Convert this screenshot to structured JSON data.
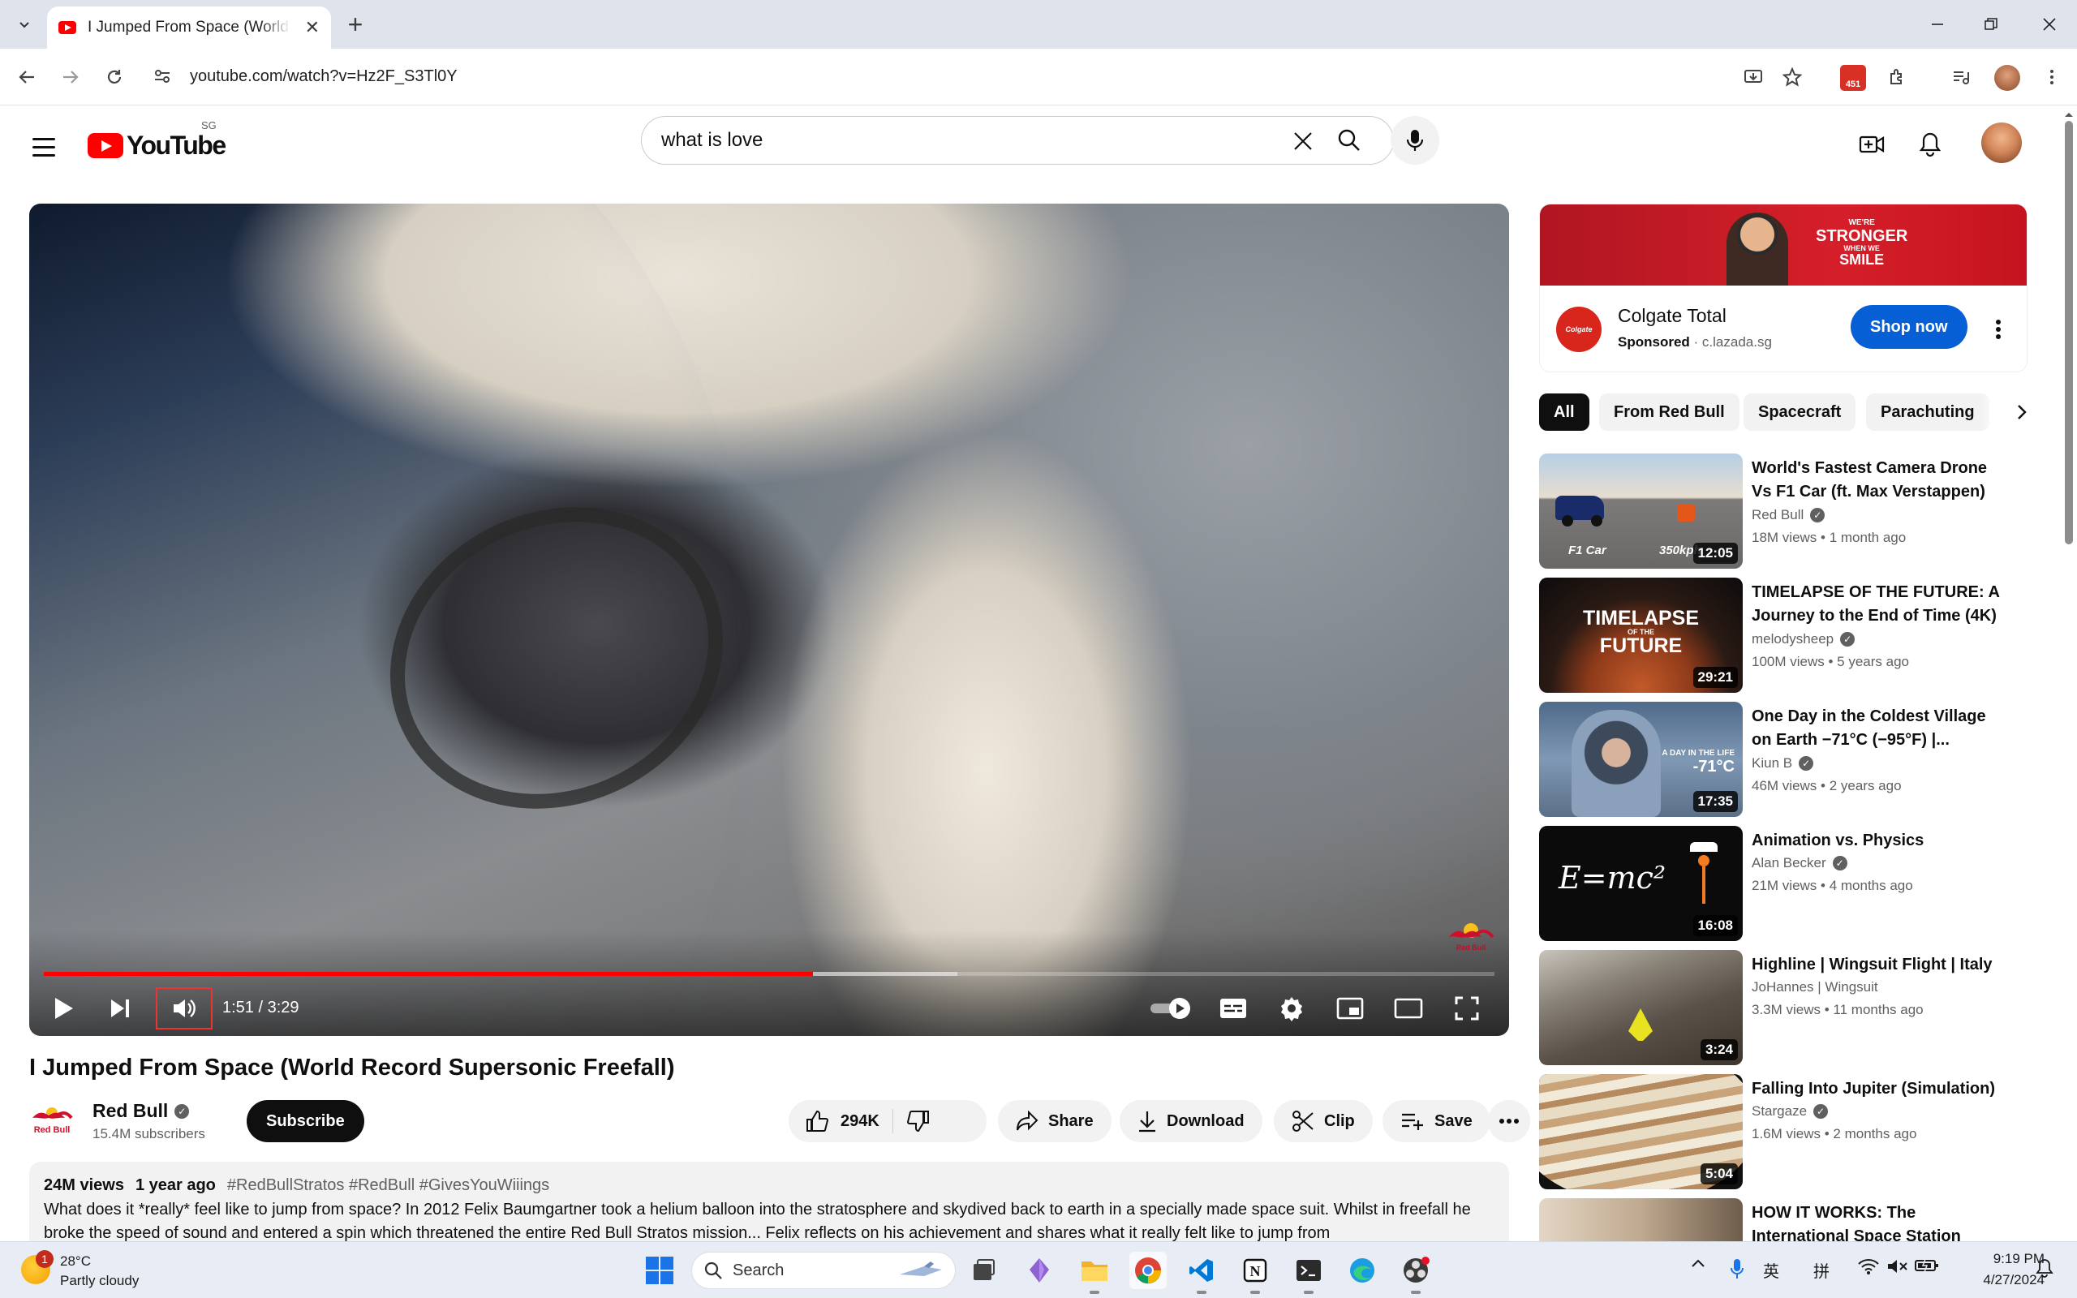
{
  "browser": {
    "tab_title": "I Jumped From Space (World Record Supersonic Freefall) - YouTube",
    "url": "youtube.com/watch?v=Hz2F_S3Tl0Y",
    "extension_badge": "451"
  },
  "youtube": {
    "logo_text": "YouTube",
    "country_code": "SG",
    "search_value": "what is love"
  },
  "player": {
    "time": "1:51 / 3:29",
    "progress_fraction": 0.53,
    "buffered_fraction": 0.63
  },
  "video": {
    "title": "I Jumped From Space (World Record Supersonic Freefall)",
    "channel": "Red Bull",
    "subscribers": "15.4M subscribers",
    "subscribe_label": "Subscribe",
    "likes": "294K",
    "share_label": "Share",
    "download_label": "Download",
    "clip_label": "Clip",
    "save_label": "Save",
    "views": "24M views",
    "age": "1 year ago",
    "tags": "#RedBullStratos #RedBull #GivesYouWiiings",
    "description": "What does it *really* feel like to jump from space? In 2012 Felix Baumgartner took a helium balloon into the stratosphere and skydived back to earth in a specially made space suit. Whilst in freefall he broke the speed of sound and entered a spin which threatened the entire Red Bull Stratos mission... Felix reflects on his achievement and shares what it really felt like to jump from"
  },
  "ad": {
    "banner_line1": "WE'RE",
    "banner_line2": "STRONGER",
    "banner_line3": "WHEN WE",
    "banner_line4": "SMILE",
    "logo_text": "Colgate",
    "title": "Colgate Total",
    "sponsored": "Sponsored",
    "domain": "· c.lazada.sg",
    "cta": "Shop now"
  },
  "chips": [
    "All",
    "From Red Bull",
    "Spacecraft",
    "Parachuting"
  ],
  "recommendations": [
    {
      "title": "World's Fastest Camera Drone Vs F1 Car (ft. Max Verstappen)",
      "channel": "Red Bull",
      "verified": true,
      "meta": "18M views  • 1 month ago",
      "duration": "12:05",
      "overlay_left": "F1 Car",
      "overlay_right": "350kph"
    },
    {
      "title": "TIMELAPSE OF THE FUTURE: A Journey to the End of Time (4K)",
      "channel": "melodysheep",
      "verified": true,
      "meta": "100M views  • 5 years ago",
      "duration": "29:21",
      "overlay_top": "TIMELAPSE",
      "overlay_mid": "OF THE",
      "overlay_bottom": "FUTURE"
    },
    {
      "title": "One Day in the Coldest Village on Earth −71°C (−95°F) |...",
      "channel": "Kiun B",
      "verified": true,
      "meta": "46M views  • 2 years ago",
      "duration": "17:35",
      "overlay_small": "A DAY IN THE LIFE",
      "overlay_big": "-71°C"
    },
    {
      "title": "Animation vs. Physics",
      "channel": "Alan Becker",
      "verified": true,
      "meta": "21M views  • 4 months ago",
      "duration": "16:08",
      "overlay_eq": "E=mc²"
    },
    {
      "title": "Highline | Wingsuit Flight | Italy",
      "channel": "JoHannes | Wingsuit",
      "verified": false,
      "meta": "3.3M views  • 11 months ago",
      "duration": "3:24"
    },
    {
      "title": "Falling Into Jupiter (Simulation)",
      "channel": "Stargaze",
      "verified": true,
      "meta": "1.6M views  • 2 months ago",
      "duration": "5:04"
    },
    {
      "title": "HOW IT WORKS: The International Space Station",
      "channel": "",
      "verified": false,
      "meta": "",
      "duration": ""
    }
  ],
  "taskbar": {
    "weather_temp": "28°C",
    "weather_cond": "Partly cloudy",
    "weather_badge": "1",
    "search_label": "Search",
    "ime1": "英",
    "ime2": "拼",
    "time": "9:19 PM",
    "date": "4/27/2024"
  },
  "colors": {
    "accent_red": "#ff0000",
    "shop_blue": "#065fd4",
    "chip_active": "#0f0f0f"
  }
}
